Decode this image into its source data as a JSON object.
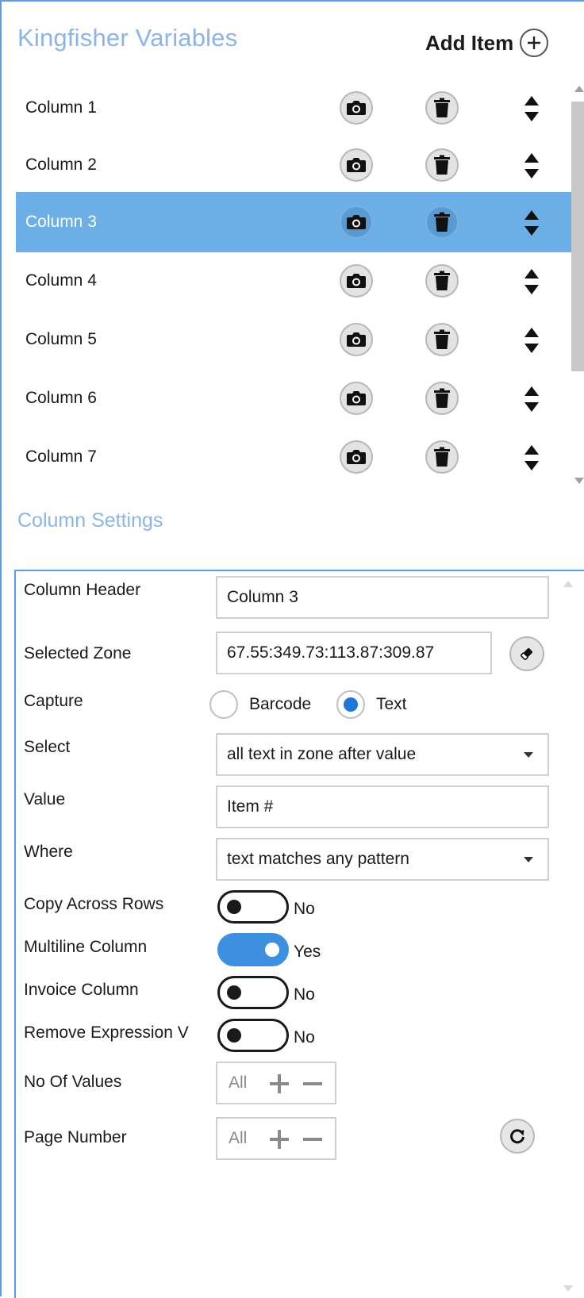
{
  "header": {
    "title": "Kingfisher Variables",
    "add_item_label": "Add Item"
  },
  "columns": {
    "selected_index": 2,
    "items": [
      {
        "label": "Column 1"
      },
      {
        "label": "Column 2"
      },
      {
        "label": "Column 3"
      },
      {
        "label": "Column 4"
      },
      {
        "label": "Column 5"
      },
      {
        "label": "Column 6"
      },
      {
        "label": "Column 7"
      }
    ]
  },
  "settings": {
    "title": "Column Settings",
    "column_header": {
      "label": "Column Header",
      "value": "Column 3"
    },
    "selected_zone": {
      "label": "Selected Zone",
      "value": "67.55:349.73:113.87:309.87"
    },
    "capture": {
      "label": "Capture",
      "option_barcode": "Barcode",
      "option_text": "Text",
      "selected": "Text"
    },
    "select": {
      "label": "Select",
      "value": "all text in zone after value"
    },
    "value": {
      "label": "Value",
      "value": "Item #"
    },
    "where": {
      "label": "Where",
      "value": "text matches any pattern"
    },
    "copy_across_rows": {
      "label": "Copy Across Rows",
      "state": "No",
      "on": false
    },
    "multiline_column": {
      "label": "Multiline Column",
      "state": "Yes",
      "on": true
    },
    "invoice_column": {
      "label": "Invoice Column",
      "state": "No",
      "on": false
    },
    "remove_expression": {
      "label": "Remove Expression V",
      "state": "No",
      "on": false
    },
    "no_of_values": {
      "label": "No Of Values",
      "value": "All"
    },
    "page_number": {
      "label": "Page Number",
      "value": "All"
    }
  },
  "icons": {
    "row_actions": [
      "camera-icon",
      "trash-icon",
      "sort-arrows-icon"
    ],
    "add": "plus-circle-icon",
    "zone_picker": "eraser-icon",
    "reset": "refresh-icon"
  },
  "colors": {
    "accent_title": "#8bb4ea",
    "selected_row": "#6caee6",
    "toggle_on": "#3d8fe0",
    "radio_on": "#1f78d8",
    "frame_border": "#5aa0e0"
  }
}
